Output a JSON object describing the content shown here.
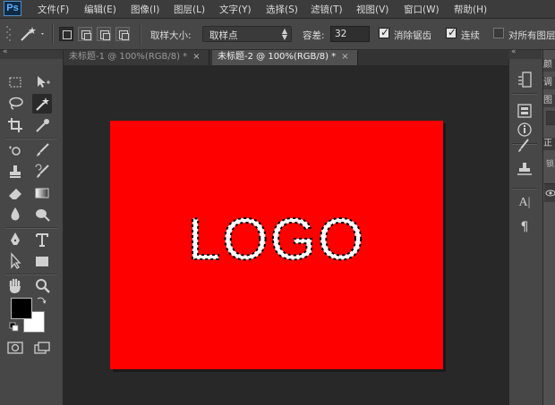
{
  "app": {
    "logo_text": "Ps"
  },
  "menu": [
    "文件(F)",
    "编辑(E)",
    "图像(I)",
    "图层(L)",
    "文字(Y)",
    "选择(S)",
    "滤镜(T)",
    "视图(V)",
    "窗口(W)",
    "帮助(H)"
  ],
  "options": {
    "sample_size_label": "取样大小:",
    "sample_size_value": "取样点",
    "tolerance_label": "容差:",
    "tolerance_value": "32",
    "antialias_label": "消除锯齿",
    "antialias_checked": true,
    "contiguous_label": "连续",
    "contiguous_checked": true,
    "sample_all_label": "对所有图层",
    "sample_all_checked": false
  },
  "tabs": [
    {
      "label": "未标题-1 @ 100%(RGB/8) *",
      "close": "×",
      "active": false
    },
    {
      "label": "未标题-2 @ 100%(RGB/8) *",
      "close": "×",
      "active": true
    }
  ],
  "document": {
    "background_color": "#fe0000",
    "text": "LOGO"
  },
  "colors": {
    "foreground": "#000000",
    "background": "#ffffff"
  },
  "right_panel_tabs": [
    "颜",
    "调",
    "图",
    "正",
    "锁"
  ],
  "right_dock": {
    "character_label": "A|",
    "paragraph_label": "¶"
  }
}
